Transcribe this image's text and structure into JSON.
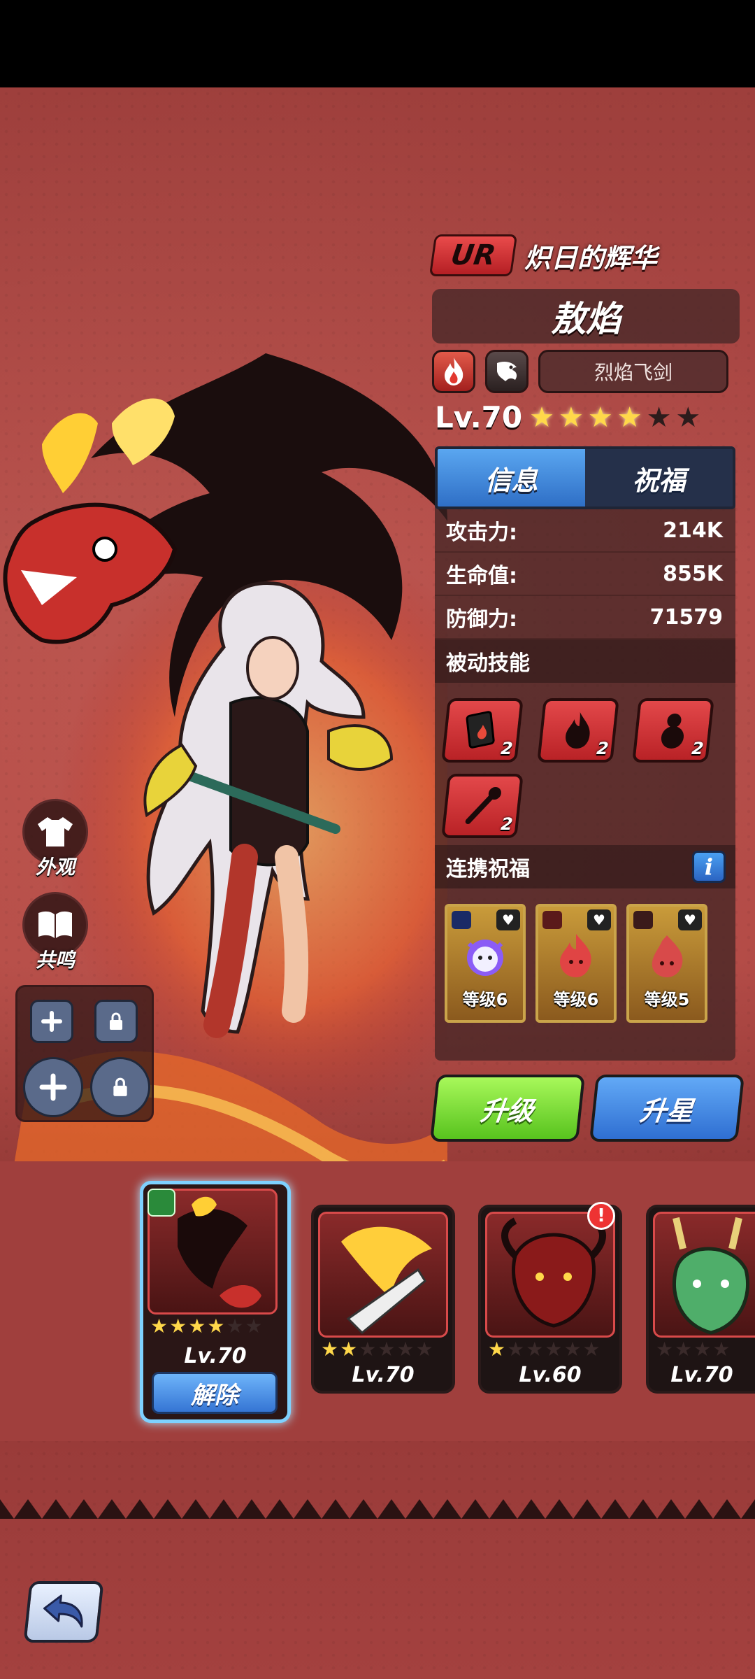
{
  "hero": {
    "rarity": "UR",
    "title": "炽日的辉华",
    "name": "敖焰",
    "weapon": "烈焰飞剑",
    "level_text": "Lv.70",
    "stars_filled": 4,
    "stars_total": 6
  },
  "tabs": [
    {
      "label": "信息",
      "active": true
    },
    {
      "label": "祝福",
      "active": false
    }
  ],
  "stats": [
    {
      "label": "攻击力:",
      "value": "214K"
    },
    {
      "label": "生命值:",
      "value": "855K"
    },
    {
      "label": "防御力:",
      "value": "71579"
    }
  ],
  "passive_skills": {
    "heading": "被动技能",
    "items": [
      {
        "icon": "card-fire-icon",
        "count": "2"
      },
      {
        "icon": "flame-icon",
        "count": "2"
      },
      {
        "icon": "gourd-icon",
        "count": "2"
      },
      {
        "icon": "staff-icon",
        "count": "2"
      }
    ]
  },
  "link_blessing": {
    "heading": "连携祝福",
    "info_label": "i",
    "items": [
      {
        "label": "等级6",
        "color": "#8b5cf6"
      },
      {
        "label": "等级6",
        "color": "#e04444"
      },
      {
        "label": "等级5",
        "color": "#d84a4a"
      }
    ]
  },
  "actions": {
    "upgrade": "升级",
    "star_up": "升星"
  },
  "side": {
    "appearance": "外观",
    "resonance": "共鸣"
  },
  "roster": [
    {
      "level": "Lv.70",
      "stars": 4,
      "selected": true,
      "release_label": "解除"
    },
    {
      "level": "Lv.70",
      "stars": 2,
      "selected": false
    },
    {
      "level": "Lv.60",
      "stars": 1,
      "selected": false,
      "alert": "!"
    },
    {
      "level": "Lv.70",
      "stars": 0,
      "selected": false
    }
  ],
  "colors": {
    "background": "#b24c49",
    "accent_blue": "#2f6fc6",
    "accent_green": "#58c31e",
    "ur_red": "#d83a3a",
    "star_gold": "#ffd84a"
  }
}
